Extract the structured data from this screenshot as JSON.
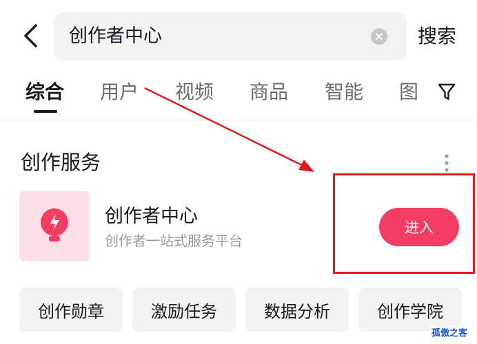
{
  "search": {
    "query": "创作者中心",
    "submit_label": "搜索"
  },
  "tabs": [
    {
      "label": "综合",
      "active": true
    },
    {
      "label": "用户",
      "active": false
    },
    {
      "label": "视频",
      "active": false
    },
    {
      "label": "商品",
      "active": false
    },
    {
      "label": "智能",
      "active": false
    },
    {
      "label": "图",
      "active": false
    }
  ],
  "card": {
    "section_title": "创作服务",
    "app_name": "创作者中心",
    "app_desc": "创作者一站式服务平台",
    "enter_label": "进入"
  },
  "chips": [
    "创作勋章",
    "激励任务",
    "数据分析",
    "创作学院"
  ],
  "watermark": "孤傲之客",
  "colors": {
    "accent": "#f43d63",
    "annotation_red": "#e11b1b",
    "icon_bg": "#fde0e5"
  },
  "icons": {
    "back": "chevron-left-icon",
    "clear": "clear-icon",
    "filter": "filter-icon",
    "more": "more-vertical-icon",
    "app": "lightbulb-icon"
  }
}
